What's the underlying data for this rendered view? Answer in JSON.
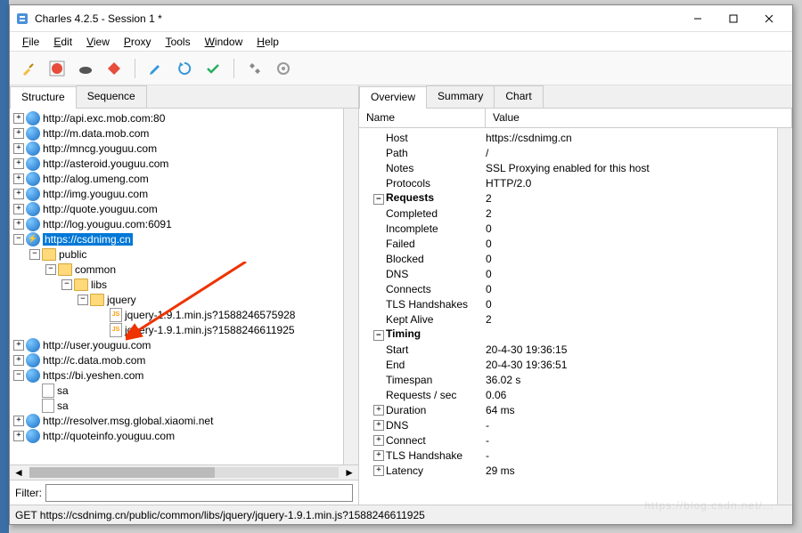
{
  "window": {
    "title": "Charles 4.2.5 - Session 1 *"
  },
  "menu": [
    "File",
    "Edit",
    "View",
    "Proxy",
    "Tools",
    "Window",
    "Help"
  ],
  "left_tabs": {
    "structure": "Structure",
    "sequence": "Sequence"
  },
  "right_tabs": {
    "overview": "Overview",
    "summary": "Summary",
    "chart": "Chart"
  },
  "tree": {
    "hosts": [
      "http://api.exc.mob.com:80",
      "http://m.data.mob.com",
      "http://mncg.youguu.com",
      "http://asteroid.youguu.com",
      "http://alog.umeng.com",
      "http://img.youguu.com",
      "http://quote.youguu.com",
      "http://log.youguu.com:6091"
    ],
    "sel": "https://csdnimg.cn",
    "folders": {
      "public": "public",
      "common": "common",
      "libs": "libs",
      "jquery": "jquery"
    },
    "files": [
      "jquery-1.9.1.min.js?1588246575928",
      "jquery-1.9.1.min.js?1588246611925"
    ],
    "after": [
      "http://user.youguu.com",
      "http://c.data.mob.com"
    ],
    "bi": {
      "host": "https://bi.yeshen.com",
      "items": [
        "sa",
        "sa"
      ]
    },
    "tail": [
      "http://resolver.msg.global.xiaomi.net",
      "http://quoteinfo.youguu.com"
    ]
  },
  "filter_label": "Filter:",
  "overview": {
    "name_col": "Name",
    "value_col": "Value",
    "rows": [
      {
        "k": "Host",
        "v": "https://csdnimg.cn"
      },
      {
        "k": "Path",
        "v": "/"
      },
      {
        "k": "Notes",
        "v": "SSL Proxying enabled for this host"
      },
      {
        "k": "Protocols",
        "v": "HTTP/2.0"
      }
    ],
    "requests": {
      "label": "Requests",
      "total": "2",
      "rows": [
        {
          "k": "Completed",
          "v": "2"
        },
        {
          "k": "Incomplete",
          "v": "0"
        },
        {
          "k": "Failed",
          "v": "0"
        },
        {
          "k": "Blocked",
          "v": "0"
        },
        {
          "k": "DNS",
          "v": "0"
        },
        {
          "k": "Connects",
          "v": "0"
        },
        {
          "k": "TLS Handshakes",
          "v": "0"
        },
        {
          "k": "Kept Alive",
          "v": "2"
        }
      ]
    },
    "timing": {
      "label": "Timing",
      "rows": [
        {
          "k": "Start",
          "v": "20-4-30 19:36:15"
        },
        {
          "k": "End",
          "v": "20-4-30 19:36:51"
        },
        {
          "k": "Timespan",
          "v": "36.02 s"
        },
        {
          "k": "Requests / sec",
          "v": "0.06"
        }
      ]
    },
    "tail": [
      {
        "k": "Duration",
        "v": "64 ms"
      },
      {
        "k": "DNS",
        "v": "-"
      },
      {
        "k": "Connect",
        "v": "-"
      },
      {
        "k": "TLS Handshake",
        "v": "-"
      },
      {
        "k": "Latency",
        "v": "29 ms"
      }
    ]
  },
  "status": "GET https://csdnimg.cn/public/common/libs/jquery/jquery-1.9.1.min.js?1588246611925"
}
